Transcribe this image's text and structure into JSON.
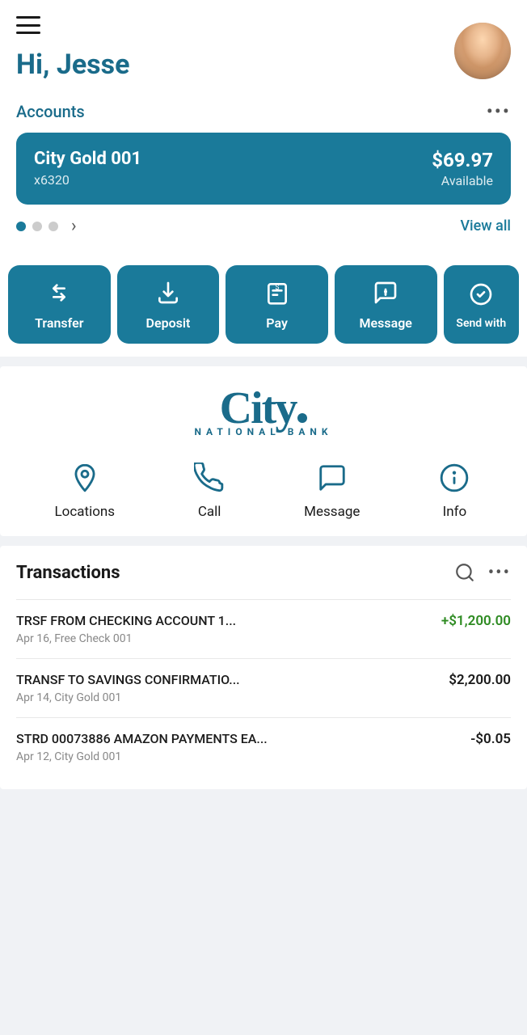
{
  "header": {
    "greeting": "Hi, Jesse",
    "menu_aria": "Open menu",
    "avatar_alt": "Jesse profile photo"
  },
  "accounts": {
    "label": "Accounts",
    "more_label": "•••",
    "view_all": "View all",
    "card": {
      "name": "City Gold 001",
      "number": "x6320",
      "balance": "$69.97",
      "balance_label": "Available"
    },
    "pagination": {
      "active": 0,
      "total": 3
    }
  },
  "actions": [
    {
      "id": "transfer",
      "label": "Transfer",
      "icon": "transfer"
    },
    {
      "id": "deposit",
      "label": "Deposit",
      "icon": "deposit"
    },
    {
      "id": "pay",
      "label": "Pay",
      "icon": "pay"
    },
    {
      "id": "message",
      "label": "Message",
      "icon": "message"
    },
    {
      "id": "send-with",
      "label": "Send with",
      "icon": "send-with"
    }
  ],
  "bank": {
    "logo_city": "City",
    "logo_national": "NATIONAL",
    "logo_bank": "BANK",
    "actions": [
      {
        "id": "locations",
        "label": "Locations",
        "icon": "location-pin"
      },
      {
        "id": "call",
        "label": "Call",
        "icon": "phone"
      },
      {
        "id": "message",
        "label": "Message",
        "icon": "chat-plus"
      },
      {
        "id": "info",
        "label": "Info",
        "icon": "info-circle"
      }
    ]
  },
  "transactions": {
    "title": "Transactions",
    "items": [
      {
        "name": "TRSF FROM CHECKING ACCOUNT 1...",
        "amount": "+$1,200.00",
        "positive": true,
        "date": "Apr 16",
        "account": "Free Check 001"
      },
      {
        "name": "TRANSF TO SAVINGS CONFIRMATIO...",
        "amount": "$2,200.00",
        "positive": false,
        "date": "Apr 14",
        "account": "City Gold 001"
      },
      {
        "name": "STRD 00073886 AMAZON PAYMENTS EA...",
        "amount": "-$0.05",
        "positive": false,
        "date": "Apr 12",
        "account": "City Gold 001"
      }
    ]
  }
}
